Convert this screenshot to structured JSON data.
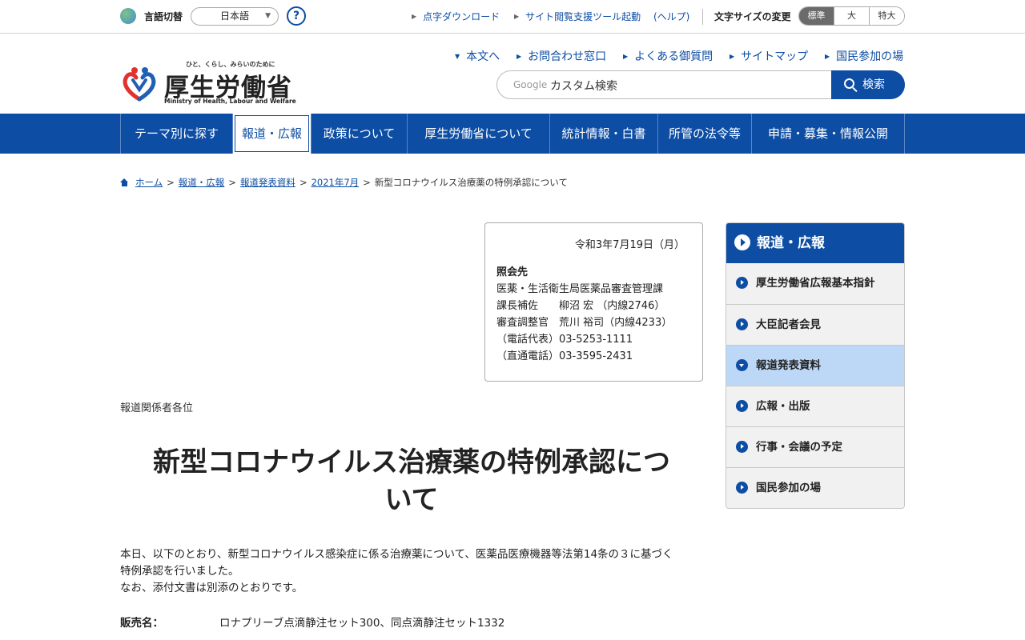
{
  "utility": {
    "lang_label": "言語切替",
    "lang_value": "日本語",
    "help": "?",
    "links": [
      "点字ダウンロード",
      "サイト閲覧支援ツール起動",
      "(ヘルプ)"
    ],
    "font_size_label": "文字サイズの変更",
    "font_sizes": [
      "標準",
      "大",
      "特大"
    ]
  },
  "header": {
    "logo_tagline": "ひと、くらし、みらいのために",
    "logo_title": "厚生労働省",
    "logo_english": "Ministry of Health, Labour and Welfare",
    "links": [
      "本文へ",
      "お問合わせ窓口",
      "よくある御質問",
      "サイトマップ",
      "国民参加の場"
    ],
    "search_brand": "Google",
    "search_placeholder": "カスタム検索",
    "search_button": "検索"
  },
  "nav": {
    "items": [
      "テーマ別に探す",
      "報道・広報",
      "政策について",
      "厚生労働省について",
      "統計情報・白書",
      "所管の法令等",
      "申請・募集・情報公開"
    ],
    "active": "報道・広報"
  },
  "breadcrumb": {
    "items": [
      "ホーム",
      "報道・広報",
      "報道発表資料",
      "2021年7月"
    ],
    "current": "新型コロナウイルス治療薬の特例承認について"
  },
  "contact": {
    "date": "令和3年7月19日（月）",
    "title": "照会先",
    "lines": [
      "医薬・生活衛生局医薬品審査管理課",
      "課長補佐　　柳沼 宏 （内線2746）",
      "審査調整官　荒川 裕司（内線4233）",
      "（電話代表）03-5253-1111",
      "（直通電話）03-3595-2431"
    ]
  },
  "article": {
    "addressee": "報道関係者各位",
    "title_line1": "新型コロナウイルス治療薬の特例承認につ",
    "title_line2": "いて",
    "body_line1": "本日、以下のとおり、新型コロナウイルス感染症に係る治療薬について、医薬品医療機器等法第14条の３に基づく",
    "body_line2": "特例承認を行いました。",
    "body_line3": "なお、添付文書は別添のとおりです。",
    "spec_label": "販売名：",
    "spec_value": "ロナプリーブ点滴静注セット300、同点滴静注セット1332"
  },
  "sidebar": {
    "title": "報道・広報",
    "items": [
      "厚生労働省広報基本指針",
      "大臣記者会見",
      "報道発表資料",
      "広報・出版",
      "行事・会議の予定",
      "国民参加の場"
    ],
    "active": "報道発表資料"
  },
  "colors": {
    "brand_blue": "#0d4da3",
    "active_side": "#bcd8f6"
  }
}
